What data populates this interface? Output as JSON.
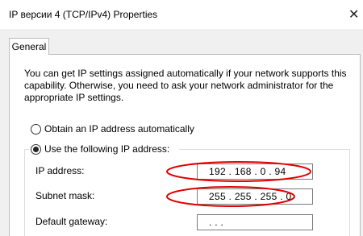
{
  "window": {
    "title": "IP версии 4 (TCP/IPv4) Properties",
    "close_glyph": "✕"
  },
  "tabs": [
    {
      "label": "General"
    }
  ],
  "description": "You can get IP settings assigned automatically if your network supports this capability. Otherwise, you need to ask your network administrator for the appropriate IP settings.",
  "options": {
    "auto": {
      "label": "Obtain an IP address automatically",
      "selected": false
    },
    "manual": {
      "label": "Use the following IP address:",
      "selected": true
    }
  },
  "fields": {
    "ip_address": {
      "label": "IP address:",
      "value": "192 . 168 .  0  . 94"
    },
    "subnet_mask": {
      "label": "Subnet mask:",
      "value": "255 . 255 . 255 .  0"
    },
    "default_gateway": {
      "label": "Default gateway:",
      "value": "  .       .       ."
    }
  },
  "annotation_color": "#e00000"
}
